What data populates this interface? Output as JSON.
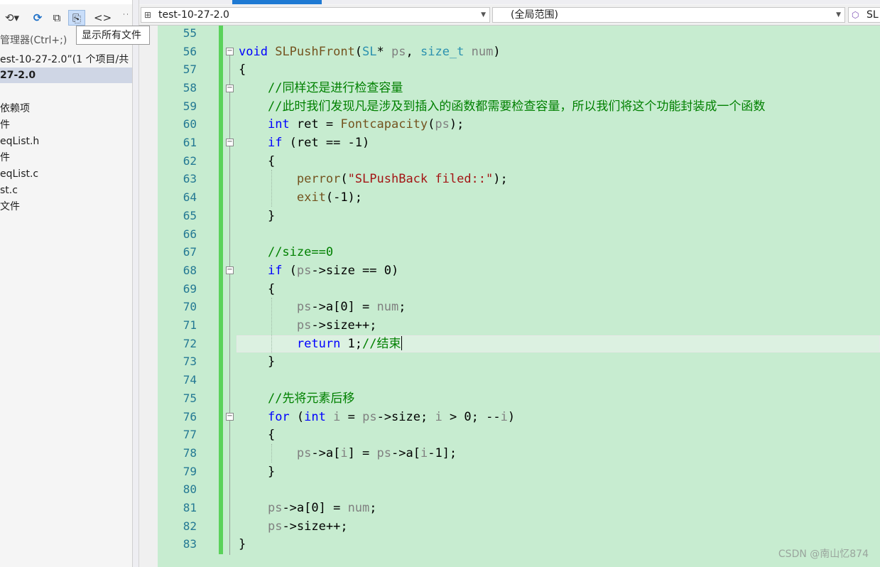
{
  "explorer": {
    "tooltip": "显示所有文件",
    "search_placeholder": "管理器(Ctrl+;)",
    "solution_label": "est-10-27-2.0”(1 个项目/共",
    "project_label": "27-2.0",
    "items": [
      "依赖项",
      "件",
      "eqList.h",
      "件",
      "eqList.c",
      "st.c",
      "文件"
    ]
  },
  "nav": {
    "project_dropdown": "test-10-27-2.0",
    "scope_dropdown": "(全局范围)",
    "member_dropdown": "SL"
  },
  "editor": {
    "line_numbers": [
      "55",
      "56",
      "57",
      "58",
      "59",
      "60",
      "61",
      "62",
      "63",
      "64",
      "65",
      "66",
      "67",
      "68",
      "69",
      "70",
      "71",
      "72",
      "73",
      "74",
      "75",
      "76",
      "77",
      "78",
      "79",
      "80",
      "81",
      "82",
      "83"
    ],
    "lines": [
      "",
      "void SLPushFront(SL* ps, size_t num)",
      "{",
      "    //同样还是进行检查容量",
      "    //此时我们发现凡是涉及到插入的函数都需要检查容量，所以我们将这个功能封装成一个函数",
      "    int ret = Fontcapacity(ps);",
      "    if (ret == -1)",
      "    {",
      "        perror(\"SLPushBack filed::\");",
      "        exit(-1);",
      "    }",
      "",
      "    //size==0",
      "    if (ps->size == 0)",
      "    {",
      "        ps->a[0] = num;",
      "        ps->size++;",
      "        return 1;//结束",
      "    }",
      "",
      "    //先将元素后移",
      "    for (int i = ps->size; i > 0; --i)",
      "    {",
      "        ps->a[i] = ps->a[i-1];",
      "    }",
      "",
      "    ps->a[0] = num;",
      "    ps->size++;",
      "}"
    ],
    "watermark": "CSDN @南山忆874"
  }
}
